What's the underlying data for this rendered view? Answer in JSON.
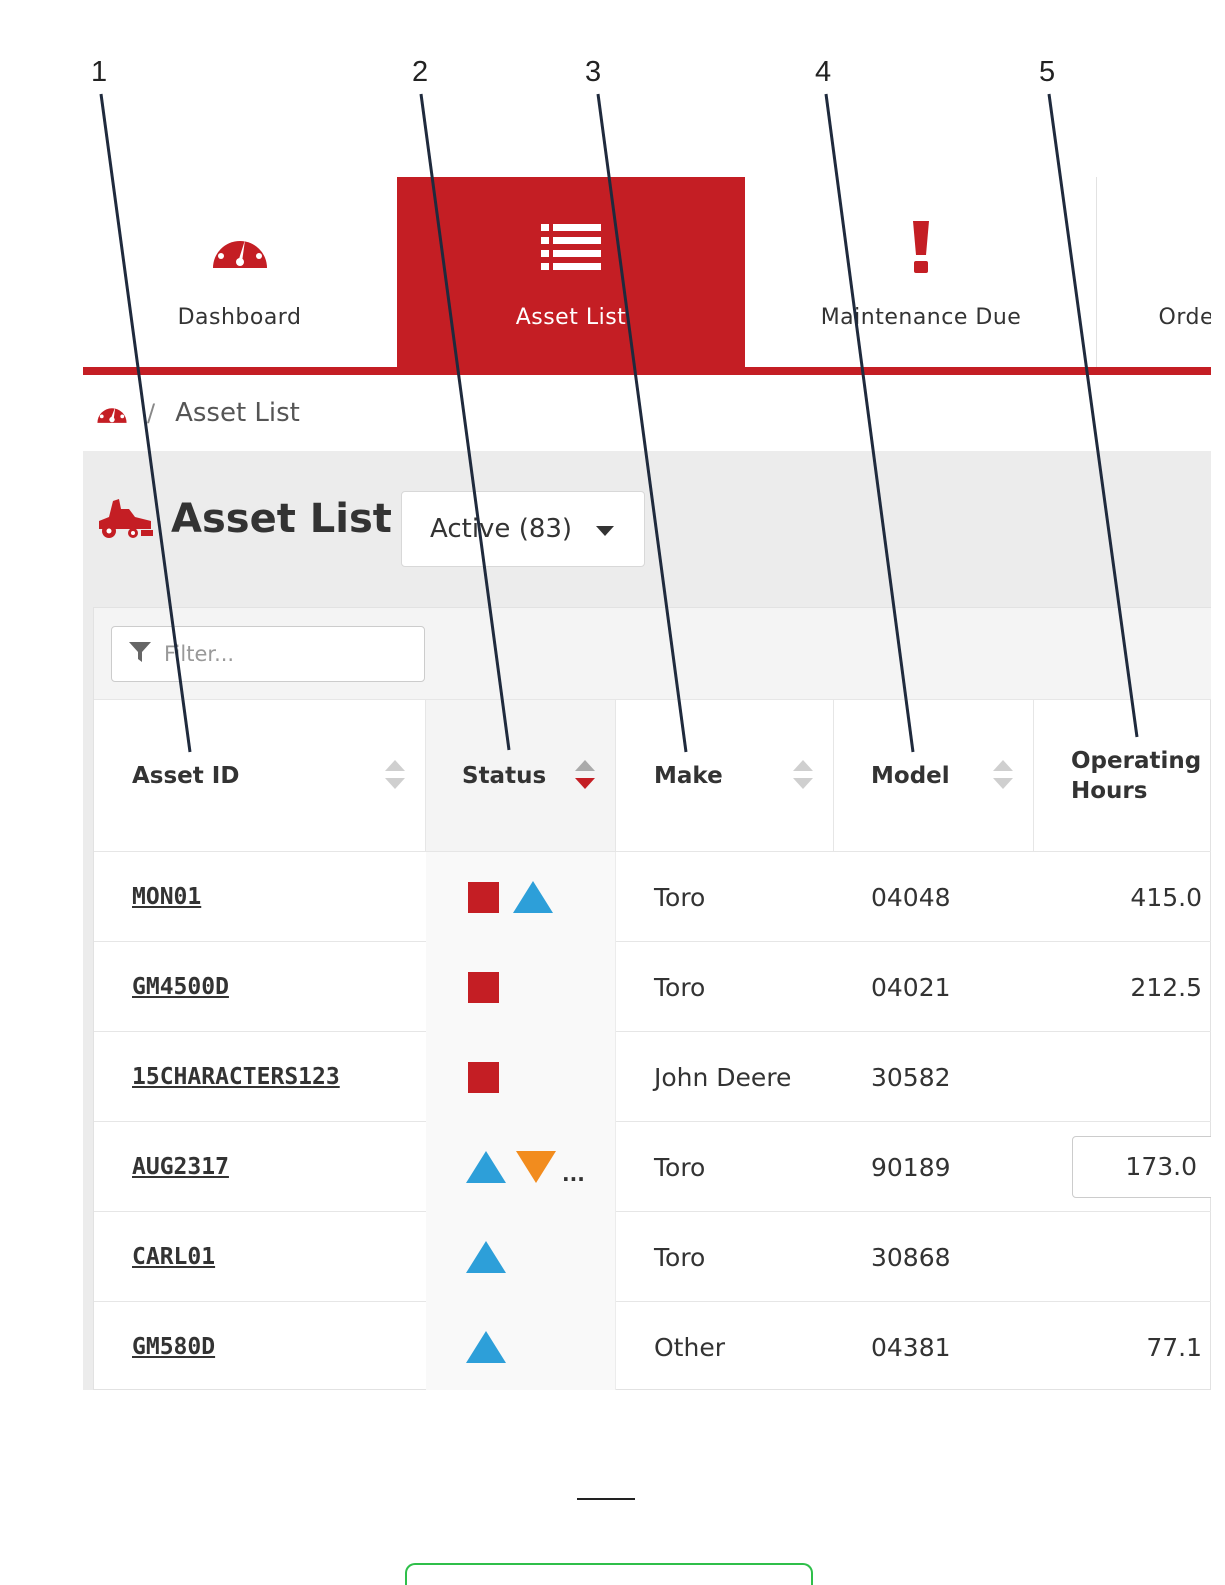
{
  "callouts": [
    "1",
    "2",
    "3",
    "4",
    "5"
  ],
  "nav": {
    "tabs": [
      {
        "label": "Dashboard",
        "icon": "speedometer-icon",
        "active": false
      },
      {
        "label": "Asset List",
        "icon": "list-icon",
        "active": true
      },
      {
        "label": "Maintenance Due",
        "icon": "exclamation-icon",
        "active": false
      },
      {
        "label": "Orders",
        "icon": "",
        "active": false
      }
    ],
    "brand_color": "#c41e24"
  },
  "breadcrumb": {
    "home_icon": "speedometer-icon",
    "separator": "/",
    "current": "Asset List"
  },
  "page": {
    "title": "Asset List",
    "title_icon": "mower-icon",
    "status_filter": {
      "selected": "Active (83)"
    }
  },
  "filter": {
    "placeholder": "Filter..."
  },
  "table": {
    "columns": [
      {
        "label": "Asset ID",
        "sort": "none"
      },
      {
        "label": "Status",
        "sort": "desc"
      },
      {
        "label": "Make",
        "sort": "none"
      },
      {
        "label": "Model",
        "sort": "none"
      },
      {
        "label": "Operating Hours",
        "sort": "none"
      }
    ],
    "rows": [
      {
        "asset_id": "MON01",
        "status": [
          "alert-square",
          "info-triangle-up"
        ],
        "make": "Toro",
        "model": "04048",
        "hours": "415.0",
        "hours_editing": false
      },
      {
        "asset_id": "GM4500D",
        "status": [
          "alert-square"
        ],
        "make": "Toro",
        "model": "04021",
        "hours": "212.5",
        "hours_editing": false
      },
      {
        "asset_id": "15CHARACTERS123",
        "status": [
          "alert-square"
        ],
        "make": "John Deere",
        "model": "30582",
        "hours": "",
        "hours_editing": false
      },
      {
        "asset_id": "AUG2317",
        "status": [
          "info-triangle-up",
          "warning-triangle-down",
          "more"
        ],
        "make": "Toro",
        "model": "90189",
        "hours": "173.0",
        "hours_editing": true
      },
      {
        "asset_id": "CARL01",
        "status": [
          "info-triangle-up"
        ],
        "make": "Toro",
        "model": "30868",
        "hours": "",
        "hours_editing": false
      },
      {
        "asset_id": "GM580D",
        "status": [
          "info-triangle-up"
        ],
        "make": "Other",
        "model": "04381",
        "hours": "77.1",
        "hours_editing": false
      }
    ],
    "more_indicator": "...",
    "status_colors": {
      "alert": "#c41e24",
      "info": "#2d9fd9",
      "warning": "#f28c1e"
    }
  }
}
